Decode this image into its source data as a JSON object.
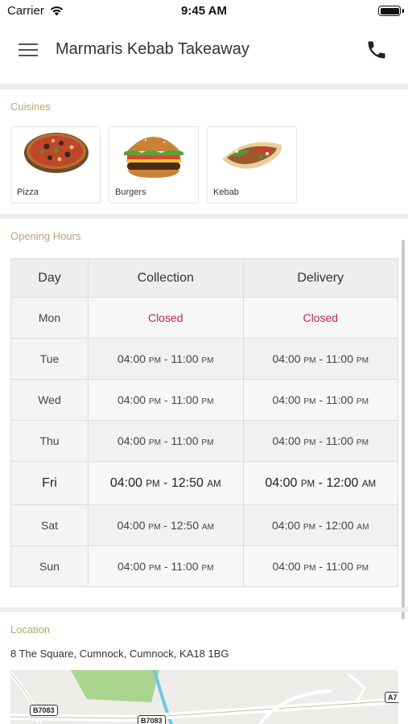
{
  "status_bar": {
    "carrier": "Carrier",
    "time": "9:45 AM",
    "icons": [
      "wifi-icon",
      "battery-icon"
    ]
  },
  "nav": {
    "title": "Marmaris Kebab Takeaway",
    "icons": [
      "hamburger-menu-icon",
      "phone-icon"
    ]
  },
  "cuisines": {
    "label": "Cuisines",
    "items": [
      {
        "name": "Pizza",
        "image": "pizza-image"
      },
      {
        "name": "Burgers",
        "image": "burger-image"
      },
      {
        "name": "Kebab",
        "image": "kebab-image"
      }
    ]
  },
  "opening_hours": {
    "label": "Opening Hours",
    "headers": {
      "day": "Day",
      "collection": "Collection",
      "delivery": "Delivery"
    },
    "rows": [
      {
        "day": "Mon",
        "collection": {
          "text": "Closed"
        },
        "delivery": {
          "text": "Closed"
        }
      },
      {
        "day": "Tue",
        "collection": {
          "open": "04:00",
          "open_ampm": "PM",
          "close": "11:00",
          "close_ampm": "PM"
        },
        "delivery": {
          "open": "04:00",
          "open_ampm": "PM",
          "close": "11:00",
          "close_ampm": "PM"
        }
      },
      {
        "day": "Wed",
        "collection": {
          "open": "04:00",
          "open_ampm": "PM",
          "close": "11:00",
          "close_ampm": "PM"
        },
        "delivery": {
          "open": "04:00",
          "open_ampm": "PM",
          "close": "11:00",
          "close_ampm": "PM"
        }
      },
      {
        "day": "Thu",
        "collection": {
          "open": "04:00",
          "open_ampm": "PM",
          "close": "11:00",
          "close_ampm": "PM"
        },
        "delivery": {
          "open": "04:00",
          "open_ampm": "PM",
          "close": "11:00",
          "close_ampm": "PM"
        }
      },
      {
        "day": "Fri",
        "collection": {
          "open": "04:00",
          "open_ampm": "PM",
          "close": "12:50",
          "close_ampm": "AM"
        },
        "delivery": {
          "open": "04:00",
          "open_ampm": "PM",
          "close": "12:00",
          "close_ampm": "AM"
        }
      },
      {
        "day": "Sat",
        "collection": {
          "open": "04:00",
          "open_ampm": "PM",
          "close": "12:50",
          "close_ampm": "AM"
        },
        "delivery": {
          "open": "04:00",
          "open_ampm": "PM",
          "close": "12:00",
          "close_ampm": "AM"
        }
      },
      {
        "day": "Sun",
        "collection": {
          "open": "04:00",
          "open_ampm": "PM",
          "close": "11:00",
          "close_ampm": "PM"
        },
        "delivery": {
          "open": "04:00",
          "open_ampm": "PM",
          "close": "11:00",
          "close_ampm": "PM"
        }
      }
    ],
    "today": "Fri"
  },
  "location": {
    "label": "Location",
    "address": "8 The Square, Cumnock, Cumnock, KA18 1BG",
    "road_labels": [
      "B7083",
      "B7083",
      "A7"
    ]
  },
  "colors": {
    "section_label": "#b3a76a",
    "closed_text": "#c0284a",
    "closed_background": "#fbe6ea"
  }
}
